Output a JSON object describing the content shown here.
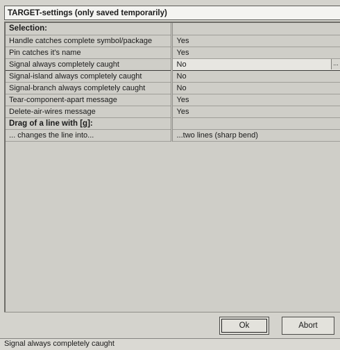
{
  "title": "TARGET-settings (only saved temporarily)",
  "rows": [
    {
      "kind": "section",
      "label": "Selection:",
      "value": ""
    },
    {
      "kind": "row",
      "label": "Handle catches complete symbol/package",
      "value": "Yes"
    },
    {
      "kind": "row",
      "label": "Pin catches it's name",
      "value": "Yes"
    },
    {
      "kind": "selected",
      "label": "Signal always completely caught",
      "value": "No",
      "button": "..."
    },
    {
      "kind": "row",
      "label": "Signal-island always completely caught",
      "value": "No"
    },
    {
      "kind": "row",
      "label": "Signal-branch always completely caught",
      "value": "No"
    },
    {
      "kind": "row",
      "label": "Tear-component-apart message",
      "value": "Yes"
    },
    {
      "kind": "row",
      "label": "Delete-air-wires message",
      "value": "Yes"
    },
    {
      "kind": "section",
      "label": "Drag of a line with [g]:",
      "value": ""
    },
    {
      "kind": "row",
      "label": "... changes the line into...",
      "value": "...two lines (sharp bend)"
    }
  ],
  "buttons": {
    "ok": "Ok",
    "abort": "Abort"
  },
  "status": "Signal always completely caught"
}
